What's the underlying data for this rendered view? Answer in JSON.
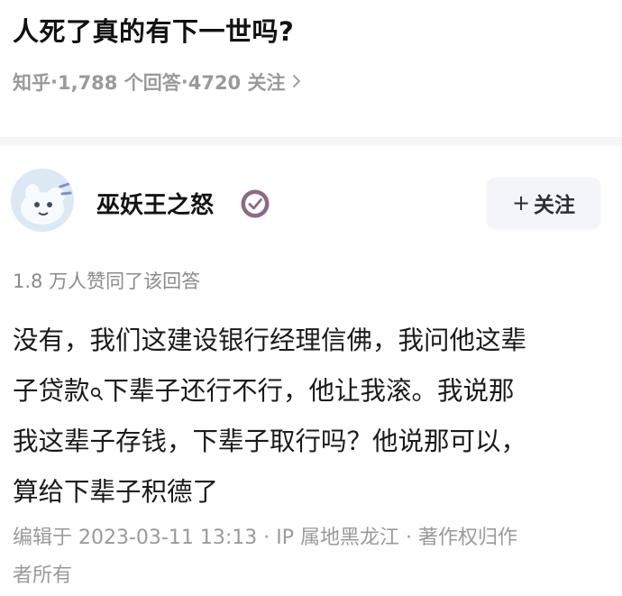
{
  "question": {
    "title": "人死了真的有下一世吗?",
    "meta": {
      "site": "知乎",
      "sep1": " · ",
      "answers": "1,788 个回答",
      "sep2": " · ",
      "followers": "4720 关注"
    }
  },
  "author": {
    "name": "巫妖王之怒",
    "follow_label": "关注"
  },
  "votes": "1.8 万人赞同了该回答",
  "answer": {
    "line1": "没有，我们这建设银行经理信佛，我问他这辈",
    "line2_a": "子贷款",
    "line2_b": "下辈子还行不行，他让我滚。我说那",
    "line3": "我这辈子存钱，下辈子取行吗？他说那可以，",
    "line4": "算给下辈子积德了"
  },
  "footer": {
    "line1": "编辑于 2023-03-11 13:13 · IP 属地黑龙江 · 著作权归作",
    "line2": "者所有"
  },
  "icons": {
    "meta_chevron": "chevron-right-icon",
    "verified": "verified-badge-icon",
    "search_link": "search-link-icon"
  },
  "colors": {
    "accent_badge": "#8a6a86",
    "meta_gray": "#9a9a9a"
  }
}
